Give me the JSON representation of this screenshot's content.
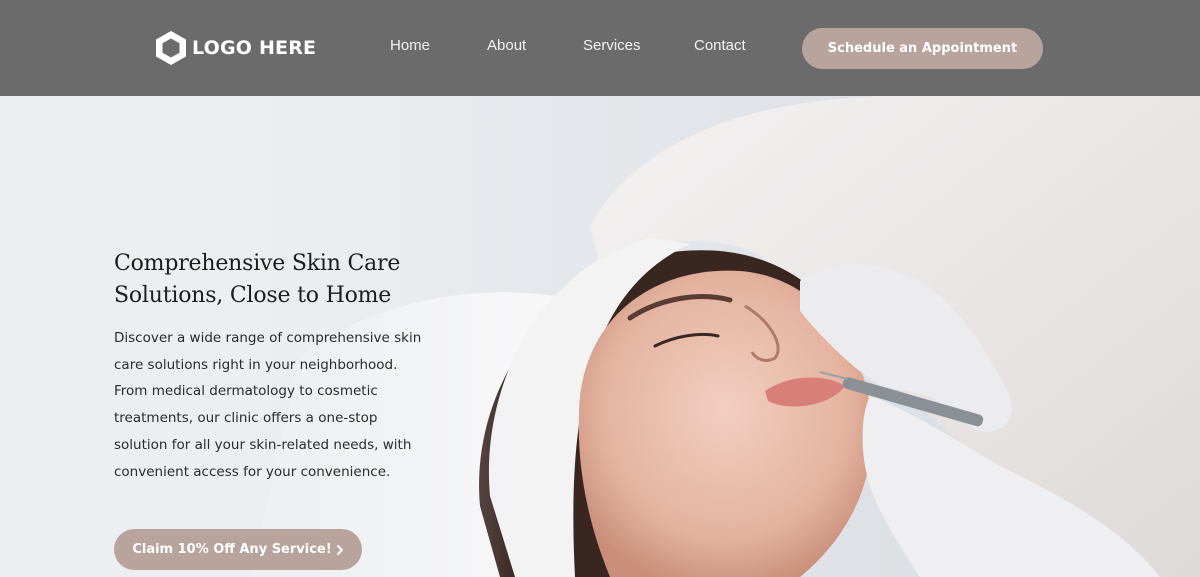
{
  "header": {
    "logo_text": "LOGO HERE",
    "logo_icon": "hexagon-logo-icon",
    "nav": [
      {
        "label": "Home"
      },
      {
        "label": "About"
      },
      {
        "label": "Services"
      },
      {
        "label": "Contact"
      }
    ],
    "cta_label": "Schedule an Appointment"
  },
  "hero": {
    "headline_line1": "Comprehensive Skin Care",
    "headline_line2": "Solutions, Close to Home",
    "description": "Discover a wide range of comprehensive skin care solutions right in your neighborhood. From medical dermatology to cosmetic treatments, our clinic offers a one-stop solution for all your skin-related needs, with convenient access for your convenience.",
    "cta_label": "Claim 10% Off Any Service!",
    "cta_icon": "chevron-right-icon"
  },
  "colors": {
    "topbar_bg": "#6b6b6b",
    "accent": "#b9a49d"
  }
}
